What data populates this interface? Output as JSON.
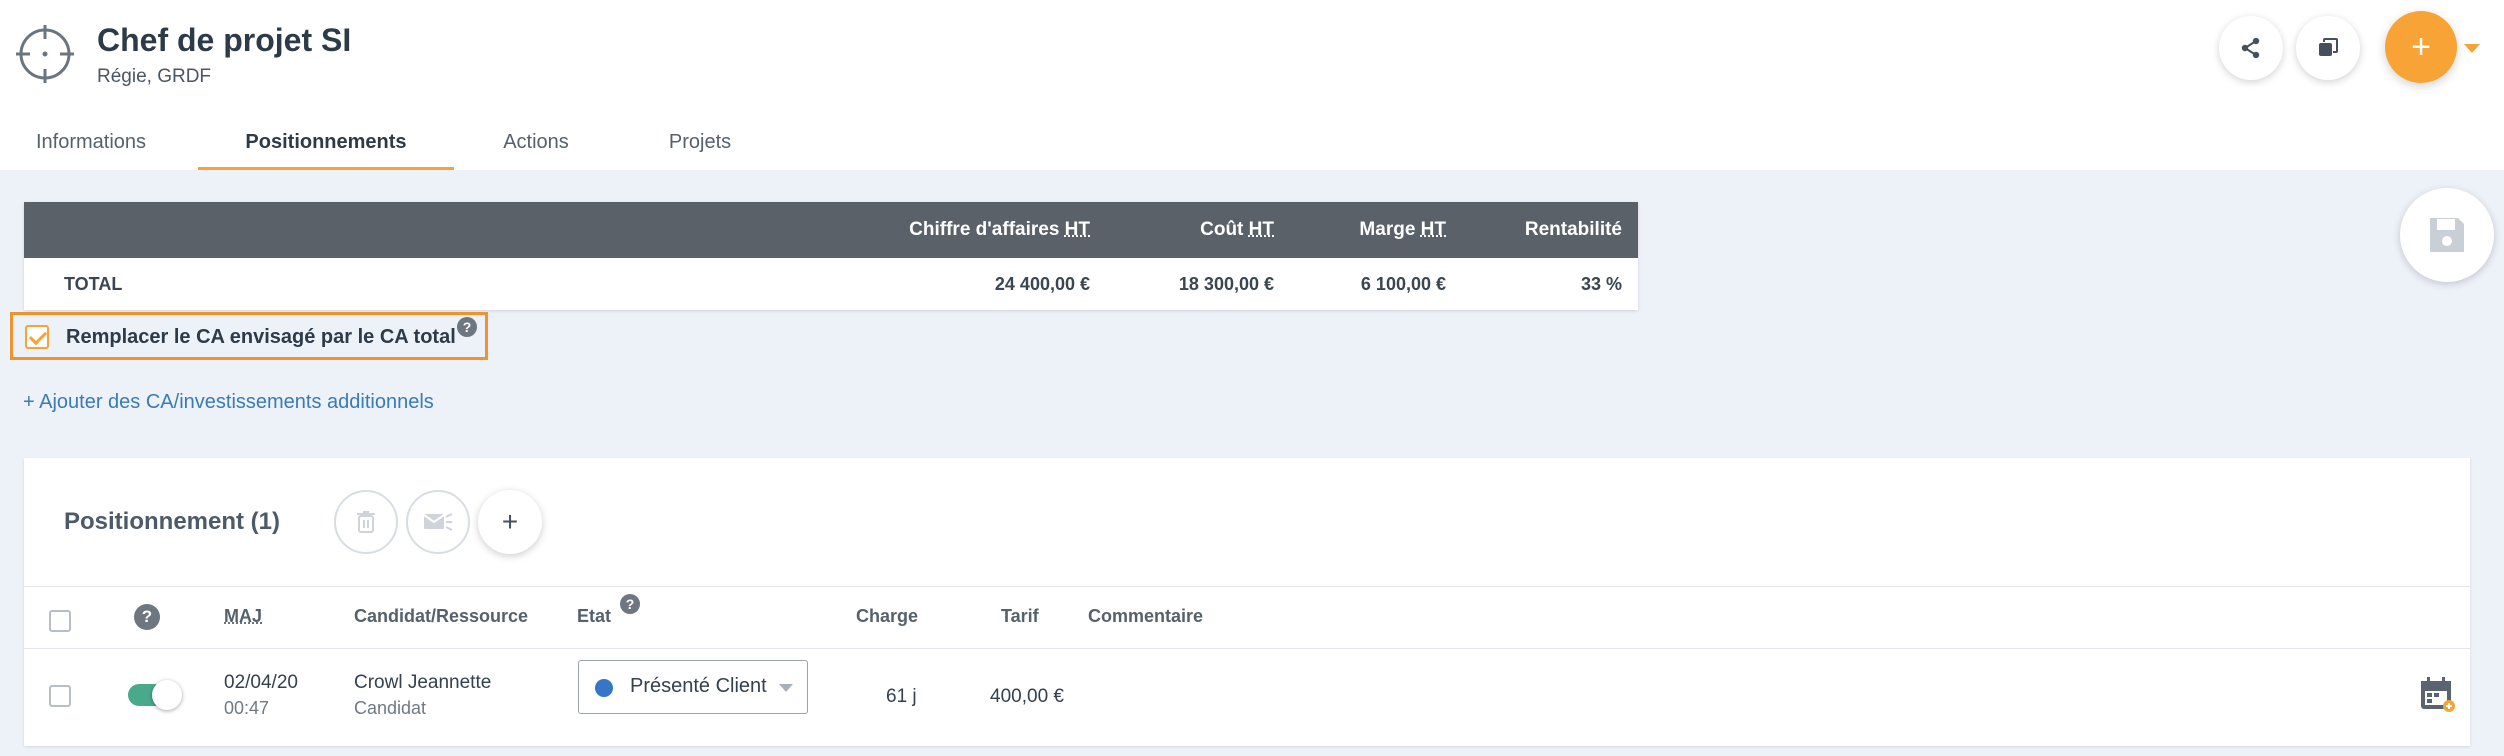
{
  "header": {
    "title": "Chef de projet SI",
    "subtitle": "Régie, GRDF",
    "plus_label": "+"
  },
  "tabs": [
    {
      "label": "Informations",
      "active": false
    },
    {
      "label": "Positionnements",
      "active": true
    },
    {
      "label": "Actions",
      "active": false
    },
    {
      "label": "Projets",
      "active": false
    }
  ],
  "summary": {
    "columns": {
      "ca_prefix": "Chiffre d'affaires ",
      "cout_prefix": "Coût ",
      "marge_prefix": "Marge ",
      "ht": "HT",
      "rentabilite": "Rentabilité"
    },
    "total": {
      "label": "TOTAL",
      "ca": "24 400,00 €",
      "cout": "18 300,00 €",
      "marge": "6 100,00 €",
      "rentabilite": "33 %"
    }
  },
  "replace_ca": {
    "label": "Remplacer le CA envisagé par le CA total",
    "checked": true
  },
  "add_link": "+ Ajouter des CA/investissements additionnels",
  "positionnement": {
    "title": "Positionnement (1)",
    "add_label": "+",
    "help_label": "?",
    "columns": {
      "maj": "MAJ",
      "candidat": "Candidat/Ressource",
      "etat": "Etat",
      "charge": "Charge",
      "tarif": "Tarif",
      "commentaire": "Commentaire"
    },
    "rows": [
      {
        "date": "02/04/20",
        "time": "00:47",
        "name": "Crowl Jeannette",
        "type": "Candidat",
        "etat": "Présenté Client",
        "charge": "61",
        "charge_unit": "j",
        "tarif": "400,00 €",
        "commentaire": ""
      }
    ]
  },
  "colors": {
    "accent": "#f7a335",
    "header_bar": "#5b6169",
    "link": "#3a7bb5",
    "status_dot": "#3577c6",
    "toggle_on": "#4aa98a"
  }
}
